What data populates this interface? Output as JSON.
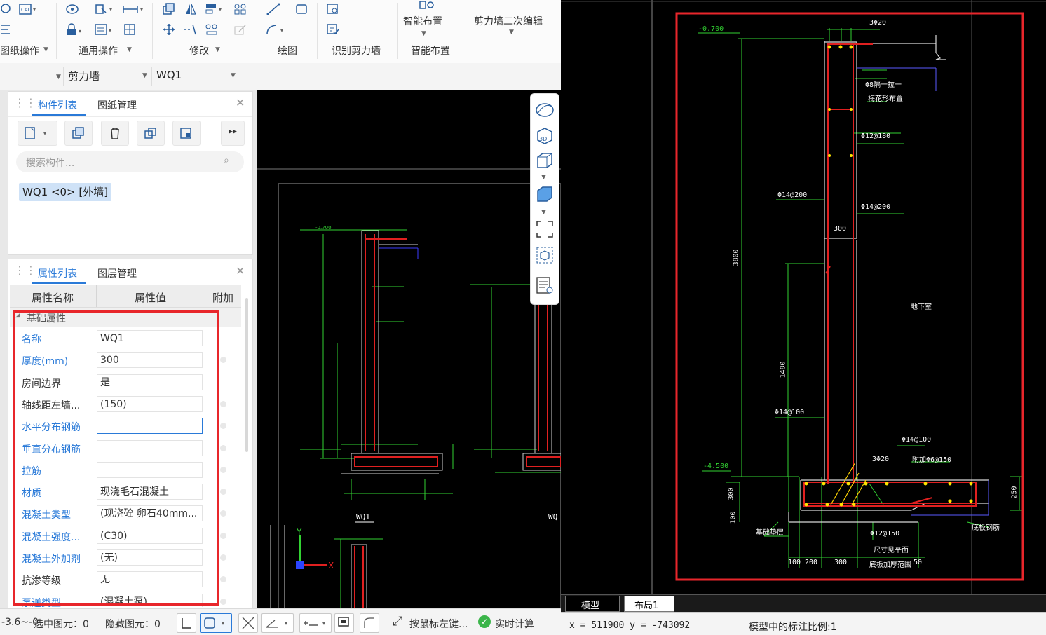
{
  "ribbon": {
    "groups": [
      {
        "label": "图纸操作"
      },
      {
        "label": "通用操作"
      },
      {
        "label": "修改"
      },
      {
        "label": "绘图"
      },
      {
        "label": "识别剪力墙"
      },
      {
        "label": "智能布置"
      }
    ],
    "big_buttons": {
      "smart_layout": "智能布置",
      "shear_wall_edit": "剪力墙二次编辑"
    }
  },
  "selector": {
    "category": "剪力墙",
    "component": "WQ1"
  },
  "component_panel": {
    "tabs": [
      "构件列表",
      "图纸管理"
    ],
    "search_placeholder": "搜索构件...",
    "items": [
      "WQ1 <0> [外墙]"
    ]
  },
  "property_panel": {
    "tabs": [
      "属性列表",
      "图层管理"
    ],
    "headers": [
      "属性名称",
      "属性值",
      "附加"
    ],
    "section": "基础属性",
    "rows": [
      {
        "name": "名称",
        "value": "WQ1",
        "blue": true
      },
      {
        "name": "厚度(mm)",
        "value": "300",
        "blue": true
      },
      {
        "name": "房间边界",
        "value": "是",
        "blue": false
      },
      {
        "name": "轴线距左墙...",
        "value": "(150)",
        "blue": false
      },
      {
        "name": "水平分布钢筋",
        "value": "",
        "blue": true
      },
      {
        "name": "垂直分布钢筋",
        "value": "",
        "blue": true
      },
      {
        "name": "拉筋",
        "value": "",
        "blue": true
      },
      {
        "name": "材质",
        "value": "现浇毛石混凝土",
        "blue": true
      },
      {
        "name": "混凝土类型",
        "value": "(现浇砼 卵石40mm...",
        "blue": true
      },
      {
        "name": "混凝土强度...",
        "value": "(C30)",
        "blue": true
      },
      {
        "name": "混凝土外加剂",
        "value": "(无)",
        "blue": true
      },
      {
        "name": "抗渗等级",
        "value": "无",
        "blue": false
      },
      {
        "name": "泵送类型",
        "value": "(混凝土泵)",
        "blue": true
      }
    ]
  },
  "statusbar": {
    "floor": "-3.6~-0.",
    "selected": "选中图元：0",
    "hidden": "隐藏图元：0",
    "hint": "按鼠标左键...",
    "realtime": "实时计算"
  },
  "cad_canvas": {
    "wall_label": "WQ1",
    "wall_label_2": "WQ"
  },
  "cad": {
    "tabs": [
      "模型",
      "布局1"
    ],
    "coords": "x = 511900  y = -743092",
    "scale_label": "模型中的标注比例:1",
    "annotations": {
      "top_rebar": "3Φ20",
      "elev_top": "-0.700",
      "note1": "Φ8隔一拉一",
      "note2": "梅花形布置",
      "r_12_180": "Φ12@180",
      "r_14_200_l": "Φ14@200",
      "r_14_200_r": "Φ14@200",
      "dim_300_wall": "300",
      "dim_3800": "3800",
      "room": "地下室",
      "dim_1480": "1480",
      "r_14_100_l": "Φ14@100",
      "r_14_100_r": "Φ14@100",
      "elev_bottom": "-4.500",
      "bot_rebar": "3Φ20",
      "r_mesh": "附加Φ6@150",
      "dim_300_left": "300",
      "dim_250": "250",
      "dim_100_left": "100",
      "base_note": "基础垫层",
      "r_12_150": "Φ12@150",
      "base_note2": "底板钢筋",
      "note3": "尺寸见平面",
      "note4": "底板加厚范围",
      "d100": "100",
      "d200": "200",
      "d300": "300",
      "d50": "50"
    }
  },
  "colors": {
    "accent": "#2a7ad8",
    "highlight_box": "#e8262b",
    "cad_bg": "#000000"
  }
}
